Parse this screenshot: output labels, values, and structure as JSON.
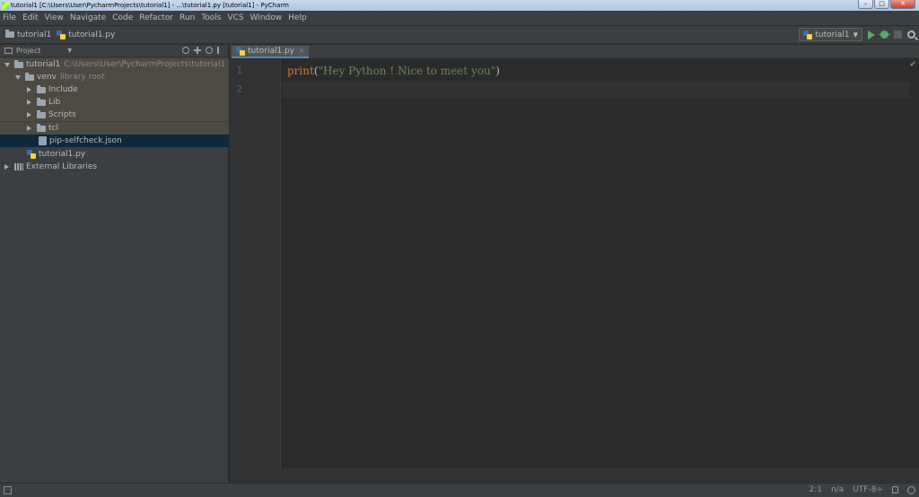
{
  "window": {
    "title": "tutorial1 [C:\\Users\\User\\PycharmProjects\\tutorial1] - ...\\tutorial1.py [tutorial1] - PyCharm",
    "controls": [
      "–",
      "□",
      "✕"
    ]
  },
  "menu": [
    "File",
    "Edit",
    "View",
    "Navigate",
    "Code",
    "Refactor",
    "Run",
    "Tools",
    "VCS",
    "Window",
    "Help"
  ],
  "navbar": {
    "crumbs": [
      "tutorial1",
      "tutorial1.py"
    ],
    "run_config": "tutorial1"
  },
  "project_panel": {
    "title": "Project",
    "tree": {
      "root": {
        "name": "tutorial1",
        "path": "C:\\Users\\User\\PycharmProjects\\tutorial1"
      },
      "venv": {
        "name": "venv",
        "note": "library root"
      },
      "venv_children": [
        "Include",
        "Lib",
        "Scripts",
        "tcl"
      ],
      "json_file": "pip-selfcheck.json",
      "py_file": "tutorial1.py",
      "external": "External Libraries"
    }
  },
  "editor": {
    "tab_label": "tutorial1.py",
    "line_numbers": [
      "1",
      "2"
    ],
    "code": {
      "func": "print",
      "open": "(",
      "string": "\"Hey Python ! Nice to meet you\"",
      "close": ")"
    }
  },
  "status": {
    "position": "2:1",
    "separator": "n/a",
    "encoding": "UTF-8÷"
  }
}
